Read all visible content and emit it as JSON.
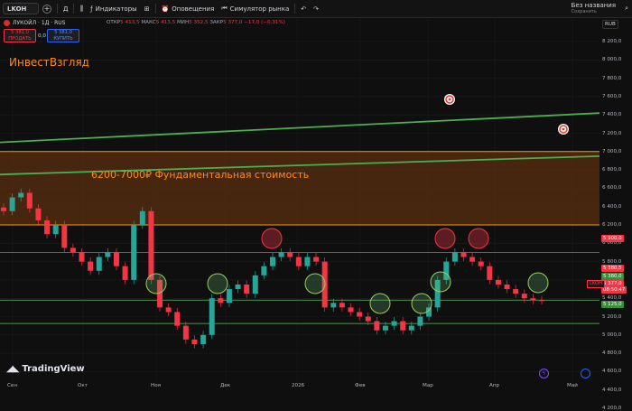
{
  "toolbar": {
    "symbol": "LKOH",
    "interval": "Д",
    "indicators_label": "Индикаторы",
    "alerts_label": "Оповещения",
    "replay_label": "Симулятор рынка",
    "layout_name": "Без названия",
    "layout_status": "Сохранить"
  },
  "legend": {
    "title": "ЛУКОЙЛ · 1Д · RUS",
    "open_label": "ОТКР",
    "open": "5 413,5",
    "high_label": "МАКС",
    "high": "5 413,5",
    "low_label": "МИН",
    "low": "5 352,5",
    "close_label": "ЗАКР",
    "close": "5 377,0",
    "change": "−17,0 (−0,31%)"
  },
  "trade": {
    "sell_price": "5 381,0",
    "sell_label": "ПРОДАТЬ",
    "spread": "0,0",
    "buy_price": "5 381,0",
    "buy_label": "КУПИТЬ"
  },
  "annotations": {
    "author": "ИнвестВзгляд",
    "zone": "6200-7000₽ Фундаментальная стоимость"
  },
  "currency": "RUB",
  "y_axis": [
    "8 200,0",
    "8 000,0",
    "7 800,0",
    "7 600,0",
    "7 400,0",
    "7 200,0",
    "7 000,0",
    "6 800,0",
    "6 600,0",
    "6 400,0",
    "6 200,0",
    "6 000,0",
    "5 800,0",
    "5 600,0",
    "5 400,0",
    "5 200,0",
    "5 000,0",
    "4 800,0",
    "4 600,0",
    "4 400,0",
    "4 200,0"
  ],
  "x_axis": [
    "Сен",
    "Окт",
    "Ноя",
    "Дек",
    "2026",
    "Фев",
    "Мар",
    "Апр",
    "Май"
  ],
  "price_tags": {
    "level_5900": "5 900,0",
    "level_5380_5": "5 380,5",
    "level_5380": "5 380,0",
    "last": "5 377,0",
    "countdown": "08:50:47",
    "level_5125": "5 125,0",
    "ticker": "LKOH"
  },
  "branding": "TradingView",
  "colors": {
    "up": "#26a69a",
    "down": "#f23645",
    "zone_fill": "#5a2f10",
    "zone_border": "#ff9800",
    "green_line": "#4caf50",
    "level_red": "#f23645",
    "support": "#66bb6a"
  },
  "chart_data": {
    "type": "candlestick",
    "x": [
      "Сен",
      "Окт",
      "Ноя",
      "Дек",
      "2026",
      "Фев",
      "Мар",
      "Апр",
      "Май"
    ],
    "close": [
      6350,
      6500,
      6550,
      6380,
      6250,
      6100,
      6200,
      5950,
      5900,
      5800,
      5700,
      5850,
      5900,
      5750,
      5600,
      6200,
      6350,
      5600,
      5300,
      5250,
      5100,
      4950,
      4900,
      5000,
      5400,
      5350,
      5500,
      5550,
      5450,
      5650,
      5750,
      5850,
      5900,
      5850,
      5750,
      5850,
      5800,
      5300,
      5350,
      5300,
      5250,
      5200,
      5150,
      5050,
      5100,
      5150,
      5050,
      5100,
      5200,
      5300,
      5600,
      5800,
      5900,
      5850,
      5800,
      5750,
      5600,
      5550,
      5500,
      5450,
      5400,
      5380,
      5377
    ],
    "levels": {
      "resistance": 5900,
      "support": 5380,
      "low_support": 5125,
      "zone": [
        6200,
        7000
      ]
    },
    "trend_lines": [
      {
        "from": 7100,
        "to": 7420
      },
      {
        "from": 6750,
        "to": 6950
      }
    ],
    "ylim": [
      4200,
      8200
    ]
  }
}
